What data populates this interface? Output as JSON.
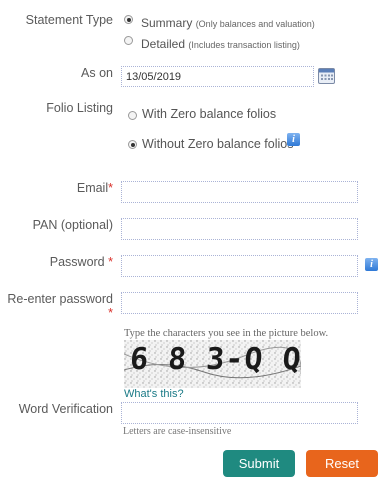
{
  "statement_type": {
    "label": "Statement Type",
    "options": [
      {
        "main": "Summary",
        "note": "(Only balances and valuation)",
        "checked": true
      },
      {
        "main": "Detailed",
        "note": "(Includes transaction listing)",
        "checked": false
      }
    ]
  },
  "as_on": {
    "label": "As on",
    "value": "13/05/2019",
    "icon": "calendar-icon"
  },
  "folio_listing": {
    "label": "Folio Listing",
    "options": [
      {
        "text": "With Zero balance folios",
        "checked": false
      },
      {
        "text": "Without Zero balance folios",
        "checked": true
      }
    ],
    "info_icon": "i"
  },
  "email": {
    "label": "Email",
    "required_mark": "*",
    "value": ""
  },
  "pan": {
    "label": "PAN (optional)",
    "value": ""
  },
  "password": {
    "label": "Password",
    "required_mark": "*",
    "value": "",
    "info_icon": "i"
  },
  "reenter_password": {
    "label": "Re-enter password",
    "required_mark": "*",
    "value": ""
  },
  "captcha": {
    "instruction": "Type the characters you see in the picture below.",
    "text": "6 8 3-Q Q",
    "whats_this": "What's this?"
  },
  "word_verification": {
    "label": "Word Verification",
    "value": "",
    "hint": "Letters are case-insensitive"
  },
  "buttons": {
    "submit": "Submit",
    "reset": "Reset",
    "submit_color": "#1f8a80",
    "reset_color": "#e8651c"
  }
}
